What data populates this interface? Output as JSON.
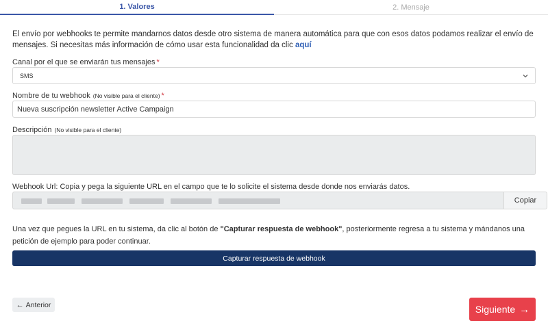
{
  "tabs": [
    {
      "label": "1. Valores",
      "active": true
    },
    {
      "label": "2. Mensaje",
      "active": false
    }
  ],
  "intro": {
    "text": "El envío por webhooks te permite mandarnos datos desde otro sistema de manera automática para que con esos datos podamos realizar el envío de mensajes. Si necesitas más información de cómo usar esta funcionalidad da clic ",
    "link": "aquí"
  },
  "channel": {
    "label": "Canal por el que se enviarán tus mensajes",
    "required_mark": "*",
    "value": "SMS"
  },
  "webhook_name": {
    "label": "Nombre de tu webhook",
    "note": "(No visible para el cliente)",
    "required_mark": "*",
    "value": "Nueva suscripción newsletter Active Campaign"
  },
  "description": {
    "label": "Descripción",
    "note": "(No visible para el cliente)",
    "value": ""
  },
  "webhook_url": {
    "label": "Webhook Url: Copia y pega la siguiente URL en el campo que te lo solicite el sistema desde donde nos enviarás datos.",
    "copy_label": "Copiar"
  },
  "info": {
    "before": "Una vez que pegues la URL en tu sistema, da clic al botón de ",
    "bold": "\"Capturar respuesta de webhook\"",
    "after": ", posteriormente regresa a tu sistema y mándanos una petición de ejemplo para poder continuar."
  },
  "capture_button": "Capturar respuesta de webhook",
  "prev_button": "Anterior",
  "next_button": "Siguiente",
  "colors": {
    "accent": "#3b57a8",
    "primary_dark": "#183566",
    "danger": "#e8414b",
    "required": "#d0333b",
    "link": "#2f5fb5"
  },
  "icons": {
    "prev": "arrow-left-icon",
    "next": "arrow-right-icon",
    "select": "chevron-down-icon"
  }
}
